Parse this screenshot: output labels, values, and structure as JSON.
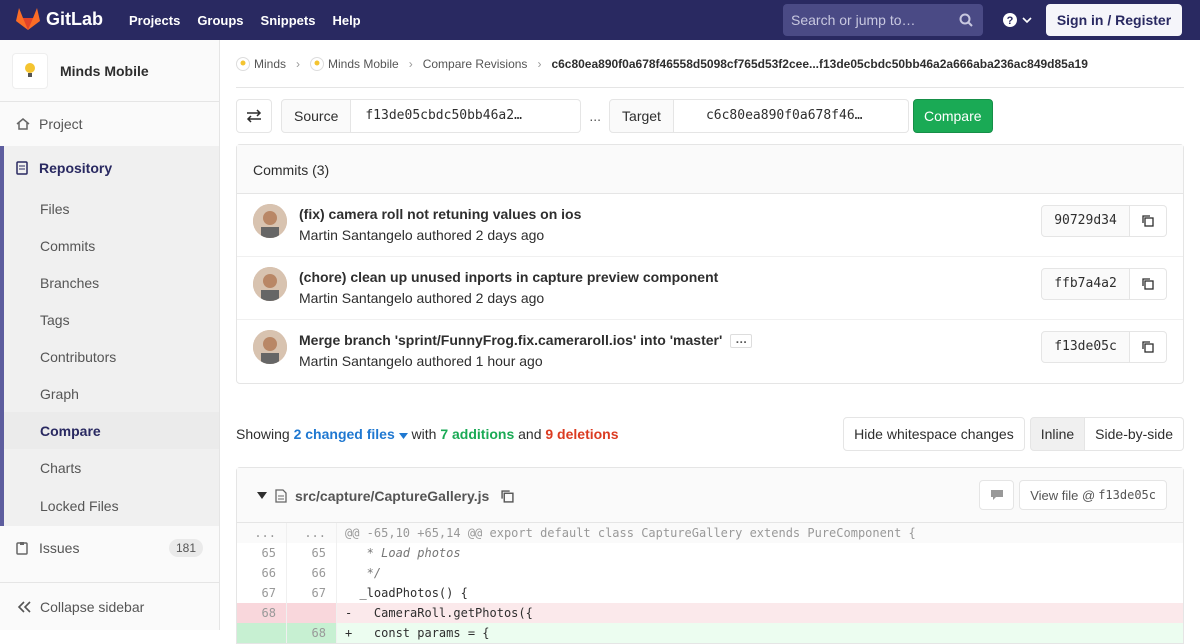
{
  "header": {
    "brand": "GitLab",
    "nav": [
      "Projects",
      "Groups",
      "Snippets",
      "Help"
    ],
    "search_placeholder": "Search or jump to…",
    "signin": "Sign in / Register"
  },
  "sidebar": {
    "project_name": "Minds Mobile",
    "project": "Project",
    "repository": "Repository",
    "items": [
      "Files",
      "Commits",
      "Branches",
      "Tags",
      "Contributors",
      "Graph",
      "Compare",
      "Charts",
      "Locked Files"
    ],
    "issues": "Issues",
    "issues_count": "181",
    "collapse": "Collapse sidebar"
  },
  "breadcrumb": {
    "items": [
      "Minds",
      "Minds Mobile",
      "Compare Revisions"
    ],
    "current": "c6c80ea890f0a678f46558d5098cf765d53f2cee...f13de05cbdc50bb46a2a666aba236ac849d85a19"
  },
  "compare": {
    "source_label": "Source",
    "source_value": "f13de05cbdc50bb46a2…",
    "dots": "...",
    "target_label": "Target",
    "target_value": "c6c80ea890f0a678f46…",
    "button": "Compare"
  },
  "commits": {
    "header": "Commits (3)",
    "list": [
      {
        "title": "(fix) camera roll not retuning values on ios",
        "author": "Martin Santangelo authored 2 days ago",
        "sha": "90729d34"
      },
      {
        "title": "(chore) clean up unused inports in capture preview component",
        "author": "Martin Santangelo authored 2 days ago",
        "sha": "ffb7a4a2"
      },
      {
        "title": "Merge branch 'sprint/FunnyFrog.fix.cameraroll.ios' into 'master'",
        "author": "Martin Santangelo authored 1 hour ago",
        "sha": "f13de05c"
      }
    ]
  },
  "stats": {
    "showing": "Showing",
    "changed": "2 changed files",
    "with": "with",
    "additions": "7 additions",
    "and": "and",
    "deletions": "9 deletions"
  },
  "view_buttons": {
    "whitespace": "Hide whitespace changes",
    "inline": "Inline",
    "side": "Side-by-side"
  },
  "file": {
    "path": "src/capture/CaptureGallery.js",
    "view_file": "View file @ ",
    "view_sha": "f13de05c",
    "lines": [
      {
        "old": "...",
        "new": "...",
        "code": "@@ -65,10 +65,14 @@ export default class CaptureGallery extends PureComponent {"
      },
      {
        "old": "65",
        "new": "65",
        "code": "   * Load photos"
      },
      {
        "old": "66",
        "new": "66",
        "code": "   */"
      },
      {
        "old": "67",
        "new": "67",
        "code": "  _loadPhotos() {"
      },
      {
        "old": "68",
        "new": "",
        "code": "-   CameraRoll.getPhotos({"
      },
      {
        "old": "",
        "new": "68",
        "code": "+   const params = {"
      }
    ]
  },
  "colors": {
    "topbar": "#292961",
    "accent": "#5d5d9e",
    "add": "#1aaa55",
    "del": "#db3b21",
    "link": "#1f78d1"
  }
}
